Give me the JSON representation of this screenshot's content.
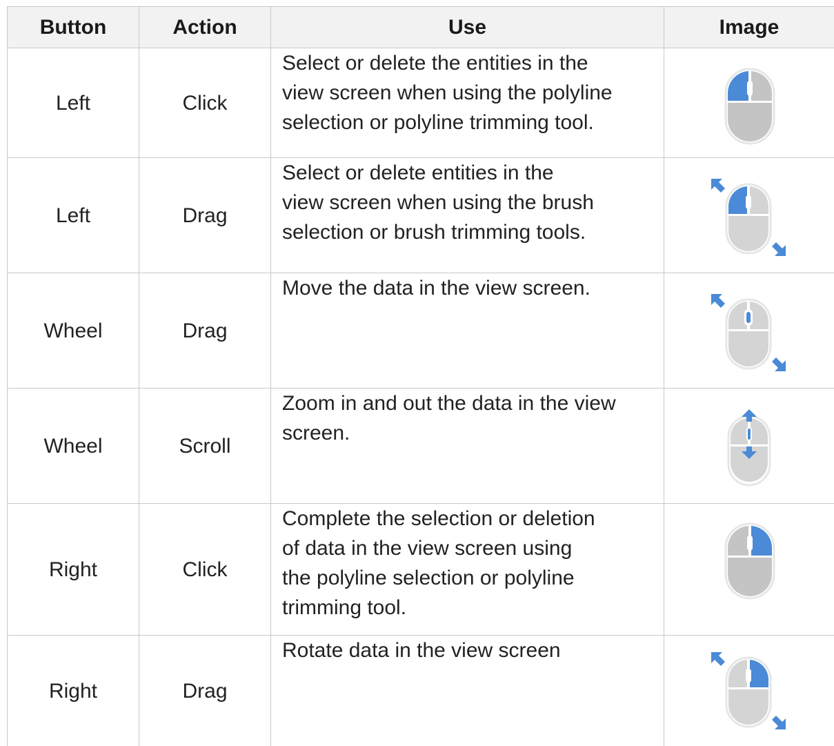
{
  "table": {
    "headers": [
      "Button",
      "Action",
      "Use",
      "Image"
    ],
    "rows": [
      {
        "button": "Left",
        "action": "Click",
        "use": [
          "Select or delete the entities in the",
          "view screen when using the polyline",
          "selection or polyline trimming tool."
        ],
        "icon": "mouse-left-click-icon"
      },
      {
        "button": "Left",
        "action": "Drag",
        "use": [
          "Select or delete entities in the",
          "view screen when using the brush",
          "selection or brush trimming tools."
        ],
        "icon": "mouse-left-drag-icon"
      },
      {
        "button": "Wheel",
        "action": "Drag",
        "use": [
          "Move the data in the view screen."
        ],
        "icon": "mouse-wheel-drag-icon"
      },
      {
        "button": "Wheel",
        "action": "Scroll",
        "use": [
          "Zoom in and out the data in the view",
          "screen."
        ],
        "icon": "mouse-wheel-scroll-icon"
      },
      {
        "button": "Right",
        "action": "Click",
        "use": [
          "Complete the selection or deletion",
          "of data in the view screen using",
          "the polyline selection or polyline",
          "trimming tool."
        ],
        "icon": "mouse-right-click-icon"
      },
      {
        "button": "Right",
        "action": "Drag",
        "use": [
          "Rotate data in the view screen"
        ],
        "icon": "mouse-right-drag-icon"
      }
    ]
  },
  "colors": {
    "accent_blue": "#4a8ad6",
    "mouse_gray": "#c4c4c4",
    "mouse_light": "#dcdcdc",
    "header_bg": "#f2f2f2",
    "border": "#c8c8c8"
  }
}
